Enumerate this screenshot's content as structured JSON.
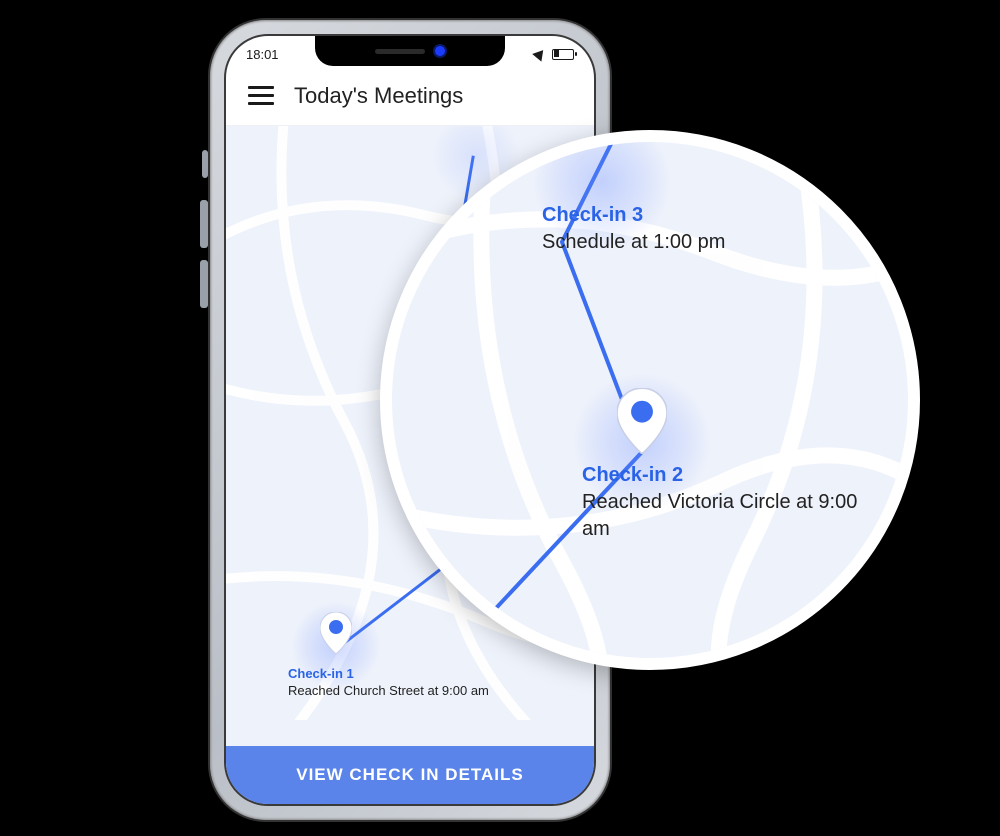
{
  "status": {
    "time": "18:01"
  },
  "header": {
    "title": "Today's Meetings"
  },
  "checkins": [
    {
      "title": "Check-in 1",
      "subtitle": "Reached Church Street at 9:00 am"
    },
    {
      "title": "Check-in 2",
      "subtitle": "Reached Victoria Circle at 9:00 am"
    },
    {
      "title": "Check-in 3",
      "subtitle": "Schedule at 1:00 pm"
    }
  ],
  "cta": {
    "label": "VIEW CHECK IN DETAILS"
  },
  "colors": {
    "accent": "#5a84ea",
    "link": "#2a63e6"
  }
}
